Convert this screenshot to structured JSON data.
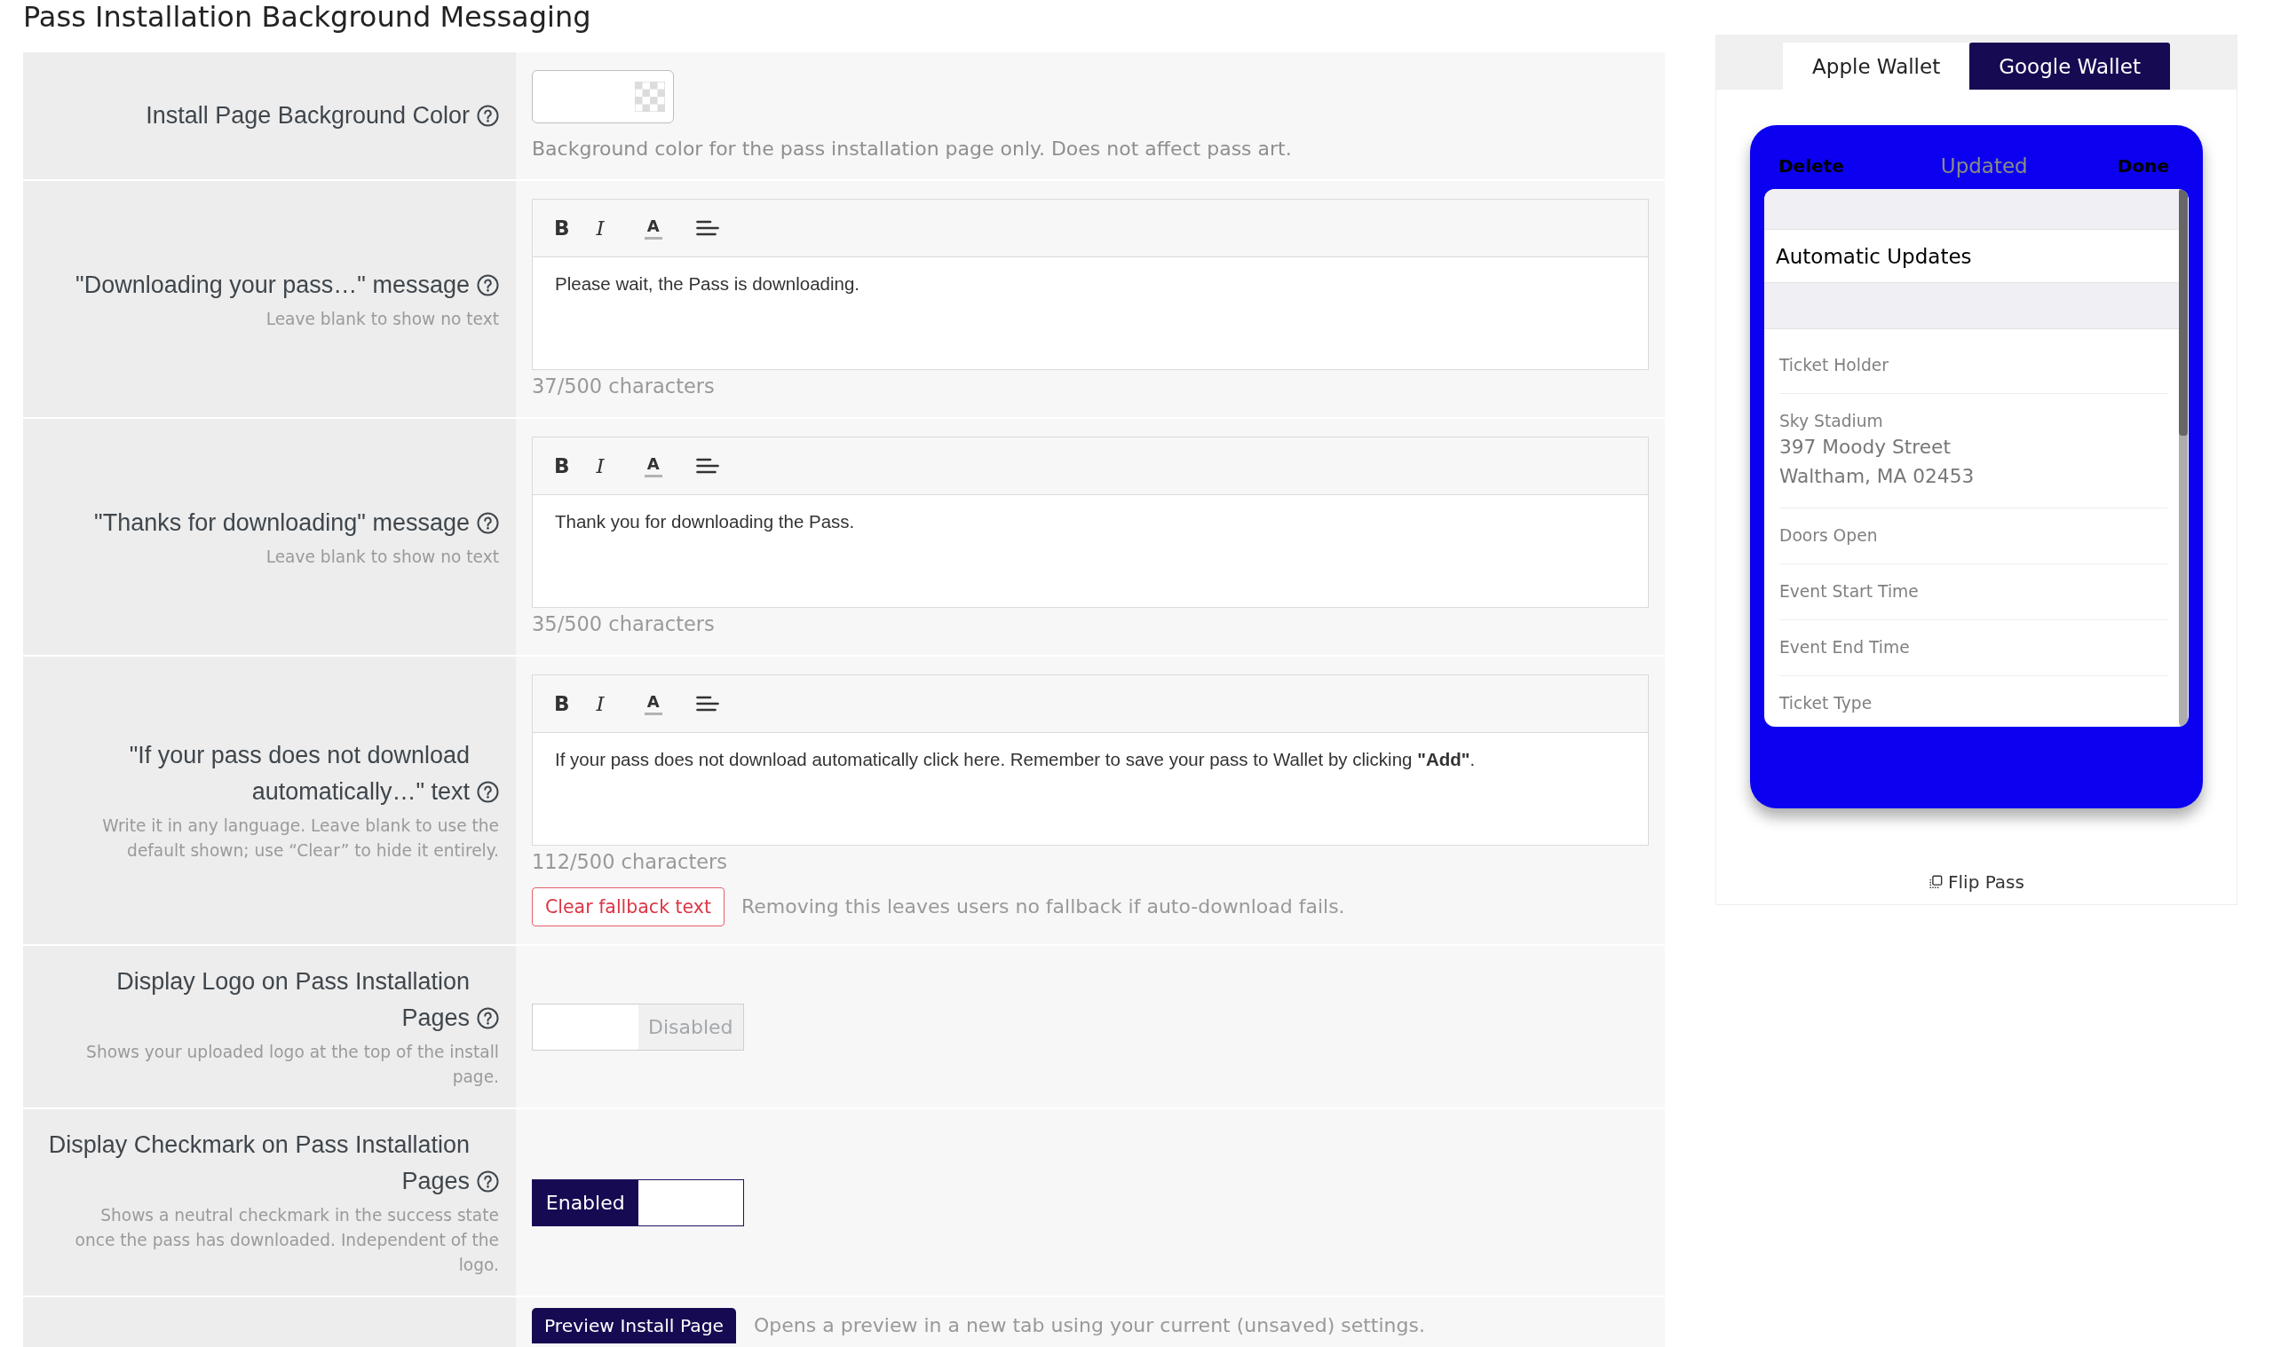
{
  "page": {
    "title": "Pass Installation Background Messaging"
  },
  "settings": [
    {
      "kind": "color",
      "label": "Install Page Background Color",
      "help": true,
      "description": "Background color for the pass installation page only. Does not affect pass art."
    },
    {
      "kind": "editor",
      "label": "\"Downloading your pass…\" message",
      "help": true,
      "hint": "Leave blank to show no text",
      "toolbar": [
        {
          "kind": "bold",
          "label": "B"
        },
        {
          "kind": "italic",
          "label": "I"
        },
        {
          "kind": "color",
          "label": "A"
        },
        {
          "kind": "align"
        }
      ],
      "content": "Please wait, the Pass is downloading.",
      "counter": "37/500 characters"
    },
    {
      "kind": "editor",
      "label": "\"Thanks for downloading\" message",
      "help": true,
      "hint": "Leave blank to show no text",
      "toolbar": [
        {
          "kind": "bold",
          "label": "B"
        },
        {
          "kind": "italic",
          "label": "I"
        },
        {
          "kind": "color",
          "label": "A"
        },
        {
          "kind": "align"
        }
      ],
      "content": "Thank you for downloading the Pass.",
      "counter": "35/500 characters"
    },
    {
      "kind": "editor",
      "label": "\"If your pass does not download automatically…\" text",
      "help": true,
      "hint": "Write it in any language. Leave blank to use the default shown; use “Clear” to hide it entirely.",
      "toolbar": [
        {
          "kind": "bold",
          "label": "B"
        },
        {
          "kind": "italic",
          "label": "I"
        },
        {
          "kind": "color",
          "label": "A"
        },
        {
          "kind": "align"
        }
      ],
      "content": "If your pass does not download automatically click here. Remember to save your pass to Wallet by clicking **\"Add\"**.",
      "counter": "112/500 characters",
      "action": {
        "label": "Clear fallback text",
        "note": "Removing this leaves users no fallback if auto-download fails."
      }
    },
    {
      "kind": "toggle",
      "label": "Display Logo on Pass Installation Pages",
      "help": true,
      "hint": "Shows your uploaded logo at the top of the install page.",
      "toggle": {
        "on": false,
        "label": "Disabled"
      }
    },
    {
      "kind": "toggle",
      "label": "Display Checkmark on Pass Installation Pages",
      "help": true,
      "hint": "Shows a neutral checkmark in the success state once the pass has downloaded. Independent of the logo.",
      "toggle": {
        "on": true,
        "label": "Enabled"
      }
    },
    {
      "kind": "button",
      "button": "Preview Install Page",
      "note": "Opens a preview in a new tab using your current (unsaved) settings."
    }
  ],
  "preview": {
    "tabs": [
      {
        "label": "Apple Wallet",
        "selected": false
      },
      {
        "label": "Google Wallet",
        "selected": true
      }
    ],
    "pass": {
      "header": {
        "left": "Delete",
        "center": "Updated",
        "right": "Done"
      },
      "setting_row": "Automatic Updates",
      "fields": [
        {
          "label": "Ticket Holder"
        },
        {
          "label": "Sky Stadium",
          "value_lines": [
            "397 Moody Street",
            "Waltham, MA 02453"
          ]
        },
        {
          "label": "Doors Open"
        },
        {
          "label": "Event Start Time"
        },
        {
          "label": "Event End Time"
        },
        {
          "label": "Ticket Type"
        }
      ]
    },
    "flip": "Flip Pass"
  }
}
